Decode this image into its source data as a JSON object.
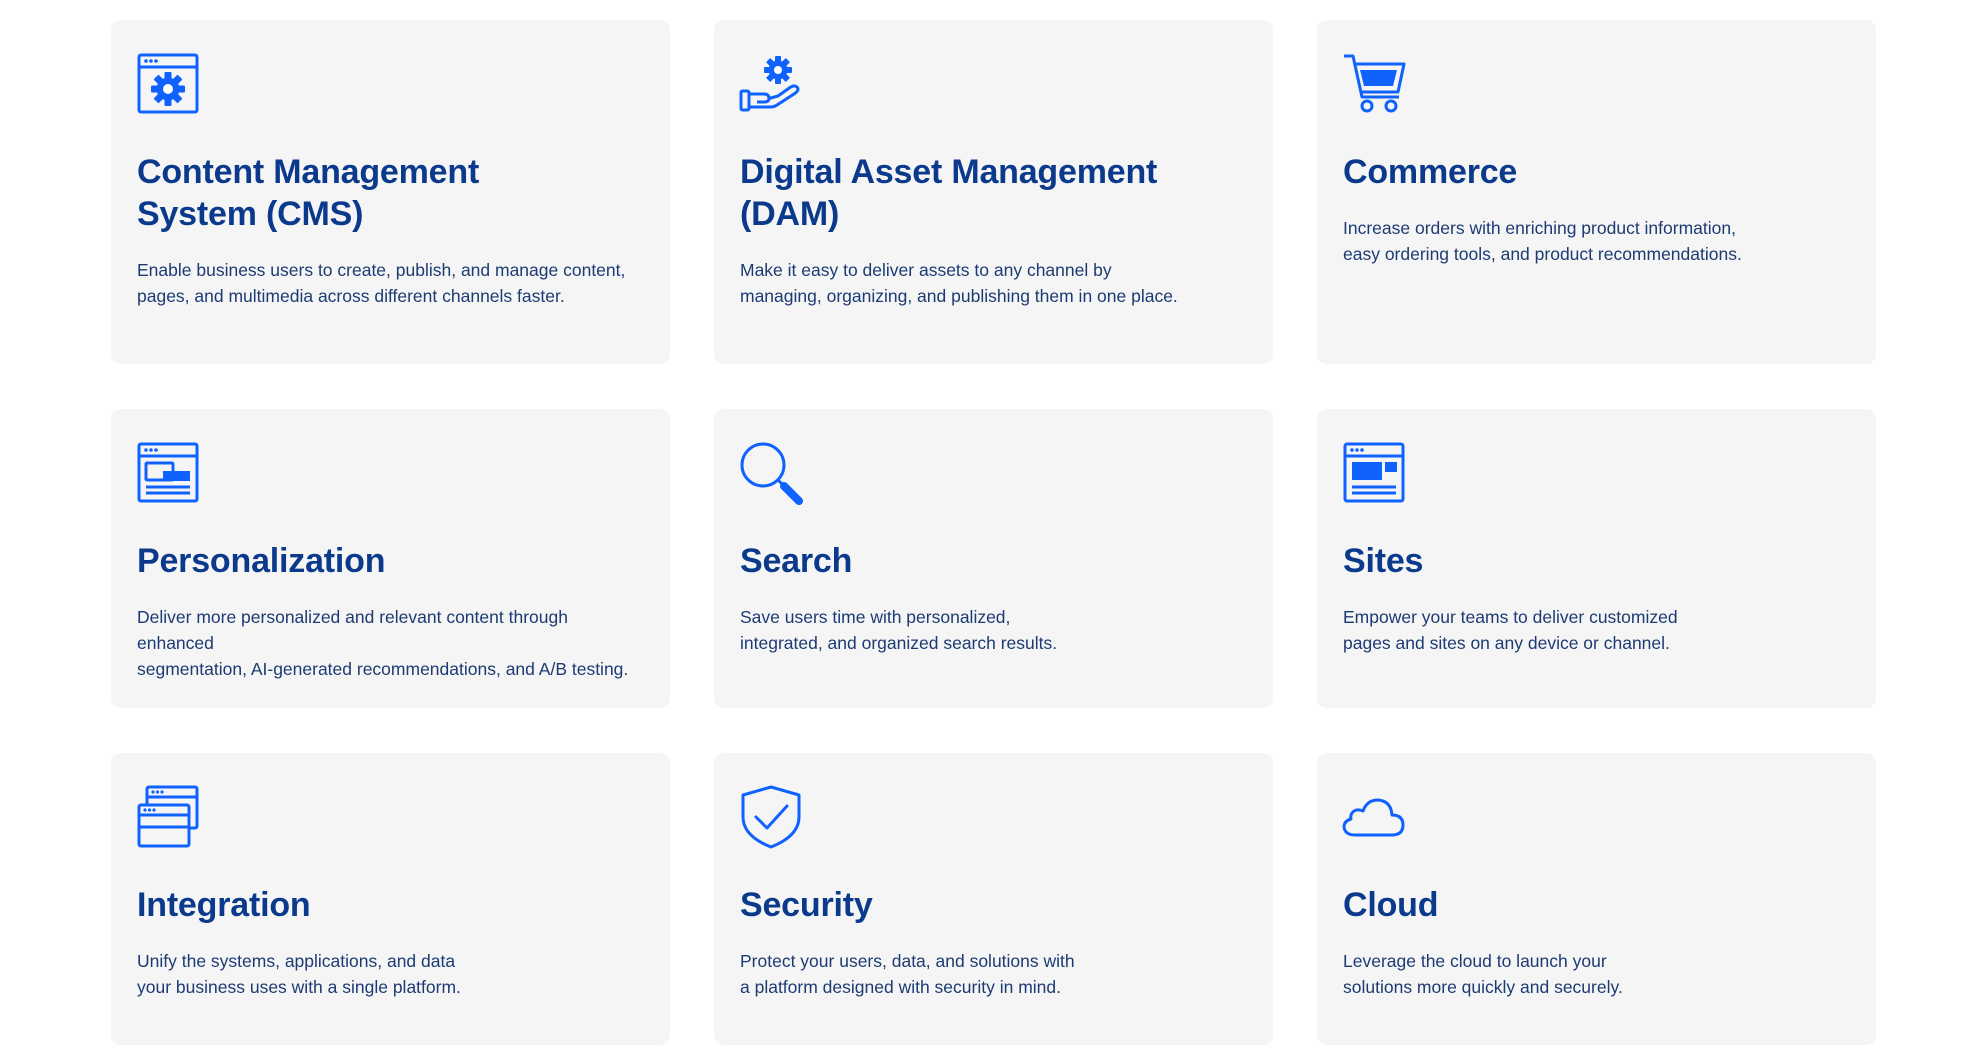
{
  "colors": {
    "card_background": "#f5f5f6",
    "title": "#0b3a8c",
    "text": "#1c3b72",
    "icon": "#0f62fe"
  },
  "cards": [
    {
      "icon": "browser-gear-icon",
      "title": "Content Management\nSystem (CMS)",
      "description": "Enable business users to create, publish, and manage content,\npages, and multimedia across different channels faster."
    },
    {
      "icon": "hand-gear-icon",
      "title": "Digital Asset Management (DAM)",
      "description": "Make it easy to deliver assets to any channel by\nmanaging, organizing, and publishing them in one place."
    },
    {
      "icon": "shopping-cart-icon",
      "title": "Commerce",
      "description": "Increase orders with enriching product information,\neasy ordering tools, and product recommendations."
    },
    {
      "icon": "browser-layout-icon",
      "title": "Personalization",
      "description": "Deliver more personalized and relevant content through enhanced\nsegmentation, AI-generated recommendations, and A/B testing."
    },
    {
      "icon": "magnifier-icon",
      "title": "Search",
      "description": "Save users time with personalized,\nintegrated, and organized search results."
    },
    {
      "icon": "browser-site-icon",
      "title": "Sites",
      "description": "Empower your teams to deliver customized\npages and sites on any device or channel."
    },
    {
      "icon": "stacked-windows-icon",
      "title": "Integration",
      "description": "Unify the systems, applications, and data\nyour business uses with a single platform."
    },
    {
      "icon": "shield-check-icon",
      "title": "Security",
      "description": "Protect your users, data, and solutions with\na platform designed with security in mind."
    },
    {
      "icon": "cloud-icon",
      "title": "Cloud",
      "description": "Leverage the cloud to launch your\nsolutions more quickly and securely."
    }
  ]
}
